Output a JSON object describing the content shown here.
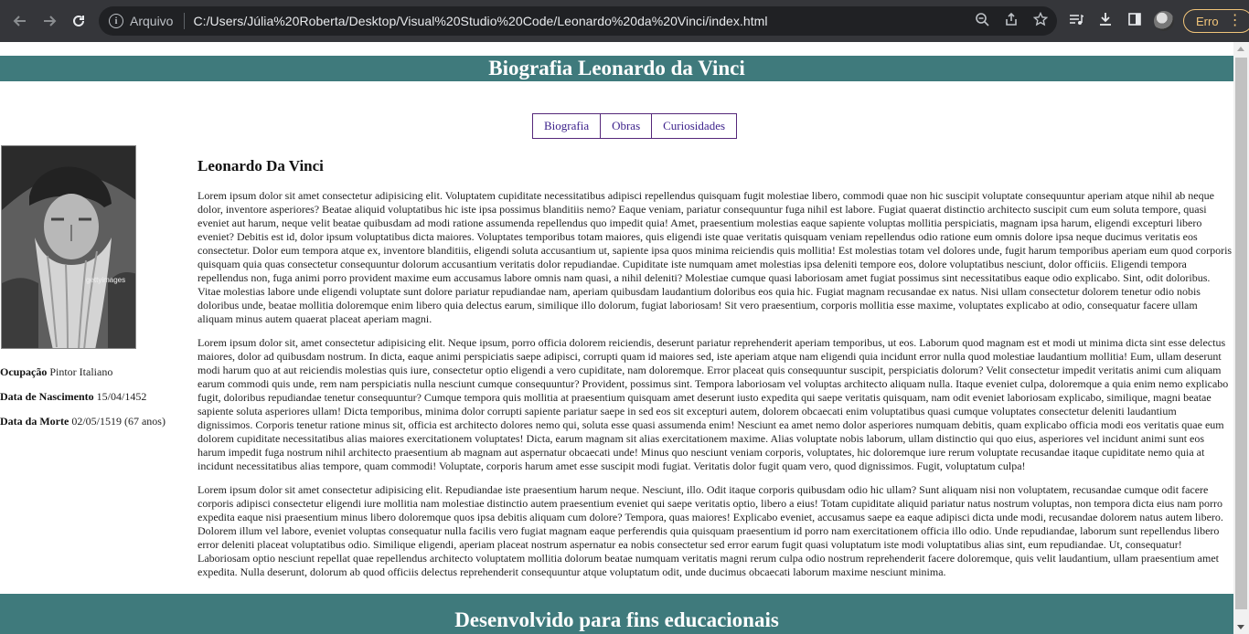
{
  "browser": {
    "scheme_label": "Arquivo",
    "url": "C:/Users/Júlia%20Roberta/Desktop/Visual%20Studio%20Code/Leonardo%20da%20Vinci/index.html",
    "error_label": "Erro",
    "icons": {
      "back": "arrow-left-icon",
      "forward": "arrow-right-icon",
      "reload": "reload-icon",
      "info": "info-icon",
      "zoom": "zoom-out-icon",
      "share": "share-icon",
      "bookmark": "star-icon",
      "media": "media-queue-icon",
      "download": "download-icon",
      "sidepanel": "side-panel-icon",
      "profile": "avatar",
      "menu": "kebab-menu-icon"
    }
  },
  "page": {
    "header_title": "Biografia Leonardo da Vinci",
    "nav": [
      {
        "label": "Biografia"
      },
      {
        "label": "Obras"
      },
      {
        "label": "Curiosidades"
      }
    ],
    "portrait": {
      "watermark": "gettyimages"
    },
    "facts": [
      {
        "label": "Ocupação",
        "value": "Pintor Italiano"
      },
      {
        "label": "Data de Nascimento",
        "value": "15/04/1452"
      },
      {
        "label": "Data da Morte",
        "value": "02/05/1519 (67 anos)"
      }
    ],
    "article_title": "Leonardo Da Vinci",
    "paragraphs": [
      "Lorem ipsum dolor sit amet consectetur adipisicing elit. Voluptatem cupiditate necessitatibus adipisci repellendus quisquam fugit molestiae libero, commodi quae non hic suscipit voluptate consequuntur aperiam atque nihil ab neque dolor, inventore asperiores? Beatae aliquid voluptatibus hic iste ipsa possimus blanditiis nemo? Eaque veniam, pariatur consequuntur fuga nihil est labore. Fugiat quaerat distinctio architecto suscipit cum eum soluta tempore, quasi eveniet aut harum, neque velit beatae quibusdam ad modi ratione assumenda repellendus quo impedit quia! Amet, praesentium molestias eaque sapiente voluptas mollitia perspiciatis, magnam ipsa harum, eligendi excepturi libero eveniet? Debitis est id, dolor ipsum voluptatibus dicta maiores. Voluptates temporibus totam maiores, quis eligendi iste quae veritatis quisquam veniam repellendus odio ratione eum omnis dolore ipsa neque ducimus veritatis eos consectetur. Dolor eum tempora atque ex, inventore blanditiis, eligendi soluta accusantium ut, sapiente ipsa quos minima reiciendis quis mollitia! Est molestias totam vel dolores unde, fugit harum temporibus aperiam eum quod corporis quisquam quia quas consectetur consequuntur dolorum accusantium veritatis dolor repudiandae. Cupiditate iste numquam amet molestias ipsa deleniti tempore eos, dolore voluptatibus nesciunt, dolor officiis. Eligendi tempora repellendus non, fuga animi porro provident maxime eum accusamus labore omnis nam quasi, a nihil deleniti? Molestiae cumque quasi laboriosam amet fugiat possimus sint necessitatibus eaque odio explicabo. Sint, odit doloribus. Vitae molestias labore unde eligendi voluptate sunt dolore pariatur repudiandae nam, aperiam quibusdam laudantium doloribus eos quia hic. Fugiat magnam recusandae ex natus. Nisi ullam consectetur dolorem tenetur odio nobis doloribus unde, beatae mollitia doloremque enim libero quia delectus earum, similique illo dolorum, fugiat laboriosam! Sit vero praesentium, corporis mollitia esse maxime, voluptates explicabo at odio, consequatur facere ullam aliquam minus autem quaerat placeat aperiam magni.",
      "Lorem ipsum dolor sit, amet consectetur adipisicing elit. Neque ipsum, porro officia dolorem reiciendis, deserunt pariatur reprehenderit aperiam temporibus, ut eos. Laborum quod magnam est et modi ut minima dicta sint esse delectus maiores, dolor ad quibusdam nostrum. In dicta, eaque animi perspiciatis saepe adipisci, corrupti quam id maiores sed, iste aperiam atque nam eligendi quia incidunt error nulla quod molestiae laudantium mollitia! Eum, ullam deserunt modi harum quo at aut reiciendis molestias quis iure, consectetur optio eligendi a vero cupiditate, nam doloremque. Error placeat quis consequuntur suscipit, perspiciatis dolorum? Velit consectetur impedit veritatis animi cum aliquam earum commodi quis unde, rem nam perspiciatis nulla nesciunt cumque consequuntur? Provident, possimus sint. Tempora laboriosam vel voluptas architecto aliquam nulla. Itaque eveniet culpa, doloremque a quia enim nemo explicabo fugit, doloribus repudiandae tenetur consequuntur? Cumque tempora quis mollitia at praesentium quisquam amet deserunt iusto expedita qui saepe veritatis quisquam, nam odit eveniet laboriosam explicabo, similique, magni beatae sapiente soluta asperiores ullam! Dicta temporibus, minima dolor corrupti sapiente pariatur saepe in sed eos sit excepturi autem, dolorem obcaecati enim voluptatibus quasi cumque voluptates consectetur deleniti laudantium dignissimos. Corporis tenetur ratione minus sit, officia est architecto dolores nemo qui, soluta esse quasi assumenda enim! Nesciunt ea amet nemo dolor asperiores numquam debitis, quam explicabo officia modi eos veritatis quae eum dolorem cupiditate necessitatibus alias maiores exercitationem voluptates! Dicta, earum magnam sit alias exercitationem maxime. Alias voluptate nobis laborum, ullam distinctio qui quo eius, asperiores vel incidunt animi sunt eos harum impedit fuga nostrum nihil architecto praesentium ab magnam aut aspernatur obcaecati unde! Minus quo nesciunt veniam corporis, voluptates, hic doloremque iure rerum voluptate recusandae itaque cupiditate nemo quia at incidunt necessitatibus alias tempore, quam commodi! Voluptate, corporis harum amet esse suscipit modi fugiat. Veritatis dolor fugit quam vero, quod dignissimos. Fugit, voluptatum culpa!",
      "Lorem ipsum dolor sit amet consectetur adipisicing elit. Repudiandae iste praesentium harum neque. Nesciunt, illo. Odit itaque corporis quibusdam odio hic ullam? Sunt aliquam nisi non voluptatem, recusandae cumque odit facere corporis adipisci consectetur eligendi iure mollitia nam molestiae distinctio autem praesentium eveniet qui saepe veritatis optio, libero a eius! Totam cupiditate aliquid pariatur natus nostrum voluptas, non tempora dicta eius nam porro expedita eaque nisi praesentium minus libero doloremque quos ipsa debitis aliquam cum dolore? Tempora, quas maiores! Explicabo eveniet, accusamus saepe ea eaque adipisci dicta unde modi, recusandae dolorem natus autem libero. Dolorem illum vel labore, eveniet voluptas consequatur nulla facilis vero fugiat magnam eaque perferendis quia quisquam praesentium id porro nam exercitationem officia illo odio. Unde repudiandae, laborum sunt repellendus libero error deleniti placeat voluptatibus odio. Similique eligendi, aperiam placeat nostrum aspernatur ea nobis consectetur sed error earum fugit quasi voluptatum iste modi voluptatibus alias sint, eum repudiandae. Ut, consequatur! Laboriosam optio nesciunt repellat quae repellendus architecto voluptatem mollitia dolorum beatae numquam veritatis magni rerum culpa odio nostrum reprehenderit facere doloremque, quis velit laudantium, ullam praesentium amet expedita. Nulla deserunt, dolorum ab quod officiis delectus reprehenderit consequuntur atque voluptatum odit, unde ducimus obcaecati laborum maxime nesciunt minima."
    ],
    "footer_text": "Desenvolvido para fins educacionais"
  },
  "colors": {
    "teal_bar": "#3f7a7c",
    "nav_border": "#55277a",
    "chrome_bg": "#35363a",
    "error_pill": "#f2c57a"
  }
}
